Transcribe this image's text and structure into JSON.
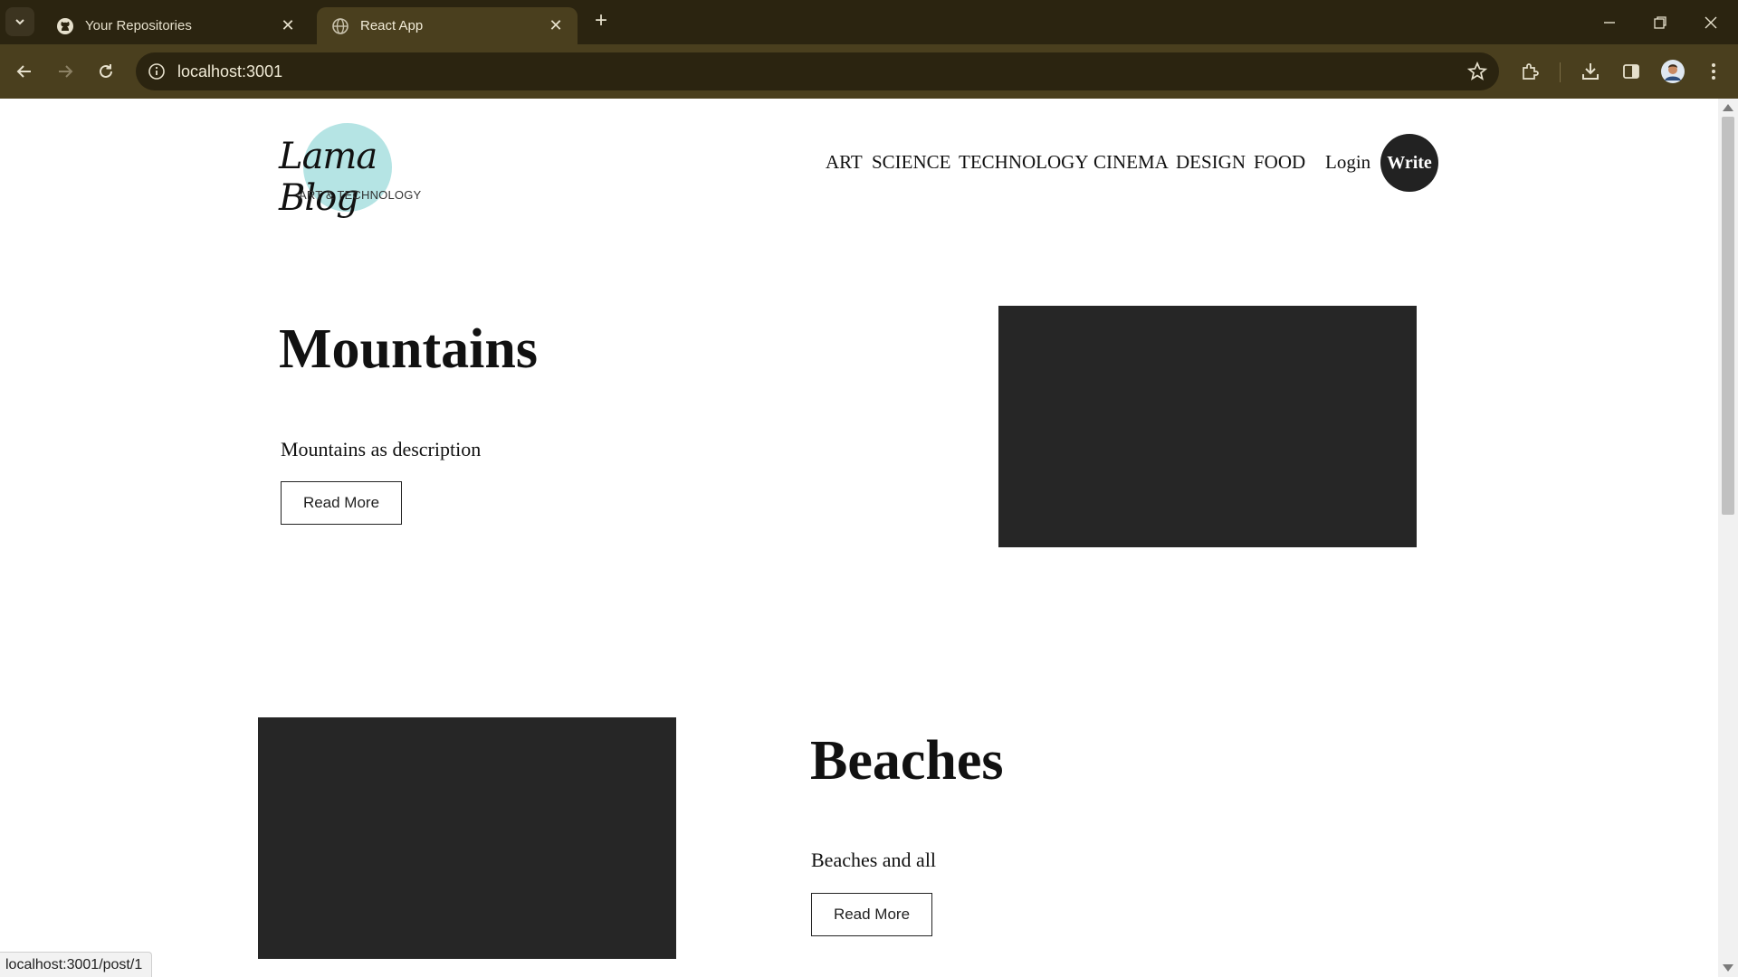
{
  "browser": {
    "tabs": [
      {
        "title": "Your Repositories",
        "favicon": "github-icon",
        "active": false
      },
      {
        "title": "React App",
        "favicon": "globe-icon",
        "active": true
      }
    ],
    "url": "localhost:3001",
    "status_url": "localhost:3001/post/1"
  },
  "colors": {
    "chrome_dark": "#2b2410",
    "chrome_toolbar": "#4a3f1e",
    "logo_circle": "#b5e4e4",
    "image_placeholder": "#262626",
    "write_button": "#222222"
  },
  "site": {
    "logo": {
      "main": "Lama Blog",
      "sub": "ART & TECHNOLOGY"
    },
    "nav": [
      "ART",
      "SCIENCE",
      "TECHNOLOGY",
      "CINEMA",
      "DESIGN",
      "FOOD"
    ],
    "login": "Login",
    "write": "Write"
  },
  "posts": [
    {
      "title": "Mountains",
      "desc": "Mountains as description",
      "button": "Read More"
    },
    {
      "title": "Beaches",
      "desc": "Beaches and all",
      "button": "Read More"
    }
  ]
}
